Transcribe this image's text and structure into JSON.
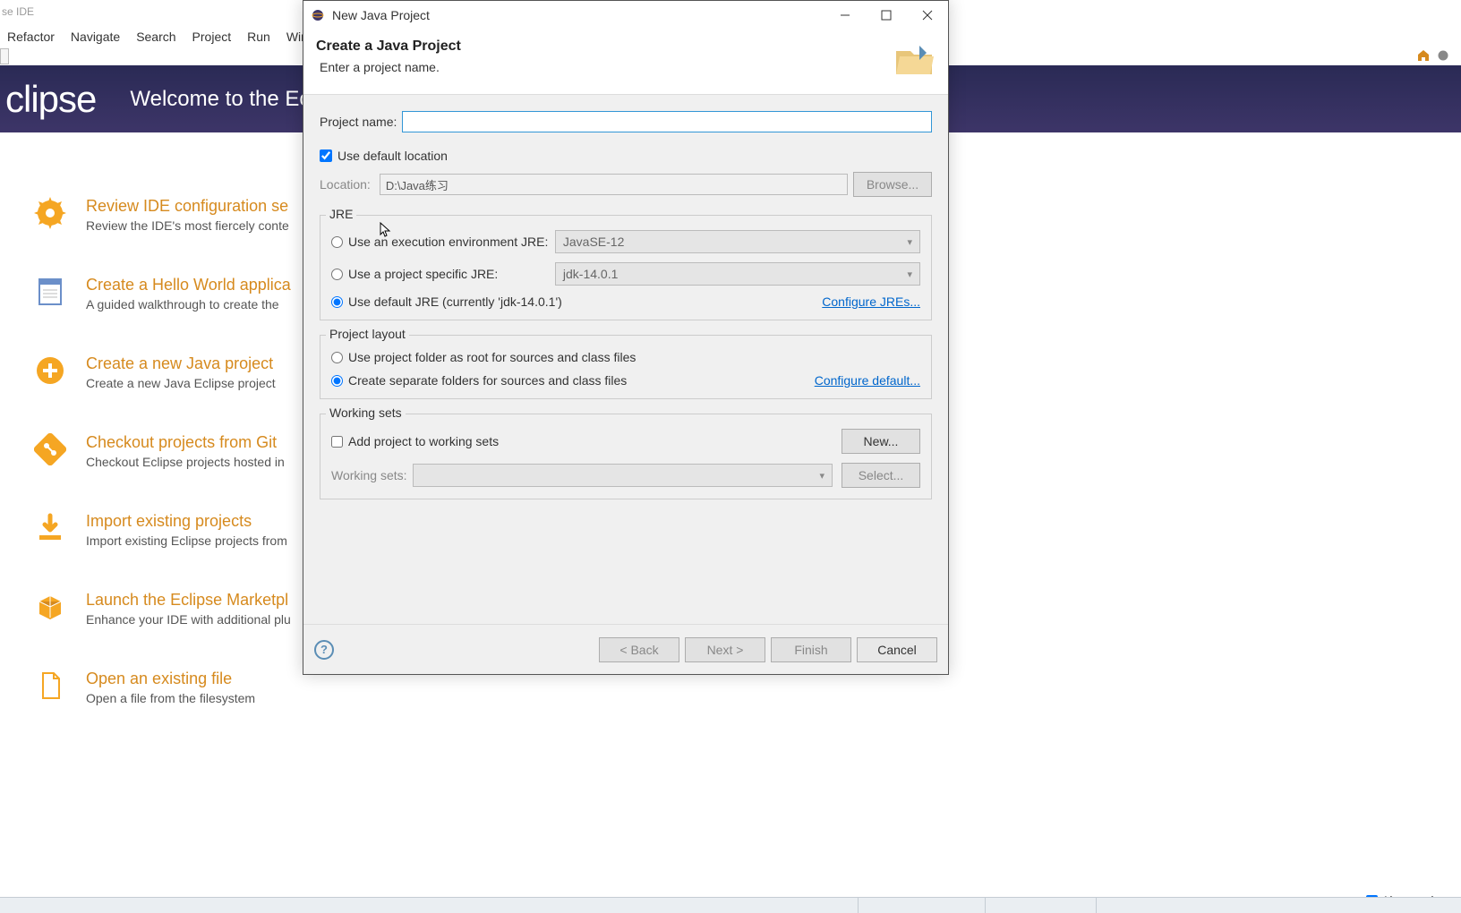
{
  "window_title": "se IDE",
  "menubar": [
    "Refactor",
    "Navigate",
    "Search",
    "Project",
    "Run",
    "Window"
  ],
  "header": {
    "logo": "clipse",
    "welcome": "Welcome to the Ecl"
  },
  "welcome_items": [
    {
      "title": "Review IDE configuration se",
      "desc": "Review the IDE's most fiercely conte"
    },
    {
      "title": "Create a Hello World applica",
      "desc": "A guided walkthrough to create the"
    },
    {
      "title": "Create a new Java project",
      "desc": "Create a new Java Eclipse project"
    },
    {
      "title": "Checkout projects from Git",
      "desc": "Checkout Eclipse projects hosted in"
    },
    {
      "title": "Import existing projects",
      "desc": "Import existing Eclipse projects from"
    },
    {
      "title": "Launch the Eclipse Marketpl",
      "desc": "Enhance your IDE with additional plu"
    },
    {
      "title": "Open an existing file",
      "desc": "Open a file from the filesystem"
    }
  ],
  "always_show": "Always show",
  "dialog": {
    "title": "New Java Project",
    "header_title": "Create a Java Project",
    "header_sub": "Enter a project name.",
    "project_name_label": "Project name:",
    "project_name_value": "",
    "use_default_location": "Use default location",
    "use_default_location_checked": true,
    "location_label": "Location:",
    "location_value": "D:\\Java练习",
    "browse": "Browse...",
    "jre": {
      "legend": "JRE",
      "opt1": "Use an execution environment JRE:",
      "opt1_value": "JavaSE-12",
      "opt2": "Use a project specific JRE:",
      "opt2_value": "jdk-14.0.1",
      "opt3": "Use default JRE (currently 'jdk-14.0.1')",
      "configure": "Configure JREs..."
    },
    "layout": {
      "legend": "Project layout",
      "opt1": "Use project folder as root for sources and class files",
      "opt2": "Create separate folders for sources and class files",
      "configure": "Configure default..."
    },
    "working_sets": {
      "legend": "Working sets",
      "add": "Add project to working sets",
      "new": "New...",
      "label": "Working sets:",
      "select": "Select..."
    },
    "footer": {
      "back": "< Back",
      "next": "Next >",
      "finish": "Finish",
      "cancel": "Cancel"
    }
  }
}
